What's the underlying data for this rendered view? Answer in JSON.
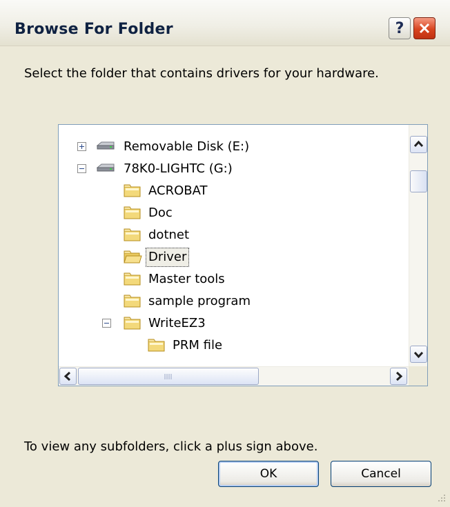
{
  "window": {
    "title": "Browse For Folder",
    "help_glyph": "?",
    "close_icon": "close-x-icon"
  },
  "prompt": "Select the folder that contains drivers for your hardware.",
  "tree": {
    "items": [
      {
        "label": "Removable Disk (E:)",
        "icon": "drive-icon",
        "expander": "plus",
        "selected": false
      },
      {
        "label": "78K0-LIGHTC (G:)",
        "icon": "drive-icon",
        "expander": "minus",
        "selected": false
      },
      {
        "label": "ACROBAT",
        "icon": "folder-icon",
        "expander": "none",
        "selected": false
      },
      {
        "label": "Doc",
        "icon": "folder-icon",
        "expander": "none",
        "selected": false
      },
      {
        "label": "dotnet",
        "icon": "folder-icon",
        "expander": "none",
        "selected": false
      },
      {
        "label": "Driver",
        "icon": "folder-icon",
        "expander": "none",
        "selected": true
      },
      {
        "label": "Master tools",
        "icon": "folder-icon",
        "expander": "none",
        "selected": false
      },
      {
        "label": "sample program",
        "icon": "folder-icon",
        "expander": "none",
        "selected": false
      },
      {
        "label": "WriteEZ3",
        "icon": "folder-icon",
        "expander": "minus",
        "selected": false
      },
      {
        "label": "PRM file",
        "icon": "folder-icon",
        "expander": "none",
        "selected": false
      }
    ],
    "vertical_scroll_fraction": 0.15,
    "horizontal_scroll_fraction": 0.0
  },
  "hint": "To view any subfolders, click a plus sign above.",
  "buttons": {
    "ok_label": "OK",
    "cancel_label": "Cancel"
  },
  "colors": {
    "dialog_bg": "#ece9d8",
    "tree_border": "#7f9db9",
    "button_border": "#003c74",
    "close_button": "#d8451f"
  }
}
